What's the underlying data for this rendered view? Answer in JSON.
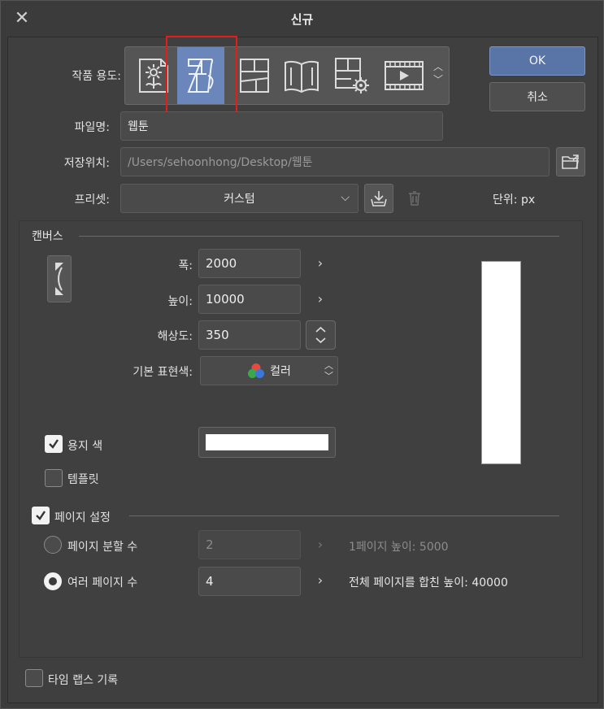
{
  "window": {
    "title": "신규",
    "close_icon": "close-icon"
  },
  "usage": {
    "label": "작품 용도:",
    "icons": [
      {
        "name": "illustration-icon",
        "selected": false
      },
      {
        "name": "webtoon-icon",
        "selected": true
      },
      {
        "name": "comic-icon",
        "selected": false
      },
      {
        "name": "book-icon",
        "selected": false
      },
      {
        "name": "comic-settings-icon",
        "selected": false
      },
      {
        "name": "animation-icon",
        "selected": false
      }
    ]
  },
  "buttons": {
    "ok": "OK",
    "cancel": "취소"
  },
  "file": {
    "name_label": "파일명:",
    "name_value": "웹툰"
  },
  "location": {
    "label": "저장위치:",
    "path": "/Users/sehoonhong/Desktop/웹툰"
  },
  "preset": {
    "label": "프리셋:",
    "value": "커스텀",
    "unit_label": "단위:",
    "unit": "px"
  },
  "canvas": {
    "section_title": "캔버스",
    "width_label": "폭:",
    "width_value": "2000",
    "height_label": "높이:",
    "height_value": "10000",
    "resolution_label": "해상도:",
    "resolution_value": "350",
    "color_label": "기본 표현색:",
    "color_value": "컬러",
    "paper_color_label": "용지 색",
    "paper_color_checked": true,
    "paper_color": "#ffffff",
    "template_label": "템플릿",
    "template_checked": false
  },
  "page_settings": {
    "label": "페이지 설정",
    "checked": true,
    "split_label": "페이지 분할 수",
    "split_value": "2",
    "split_info": "1페이지 높이: 5000",
    "multi_label": "여러 페이지 수",
    "multi_value": "4",
    "multi_info": "전체 페이지를 합친 높이: 40000",
    "selected": "multi"
  },
  "timelapse": {
    "label": "타임 랩스 기록",
    "checked": false
  },
  "colors": {
    "accent": "#6b86bb",
    "ok_button": "#5974a7",
    "highlight_frame": "#e31c1c"
  }
}
